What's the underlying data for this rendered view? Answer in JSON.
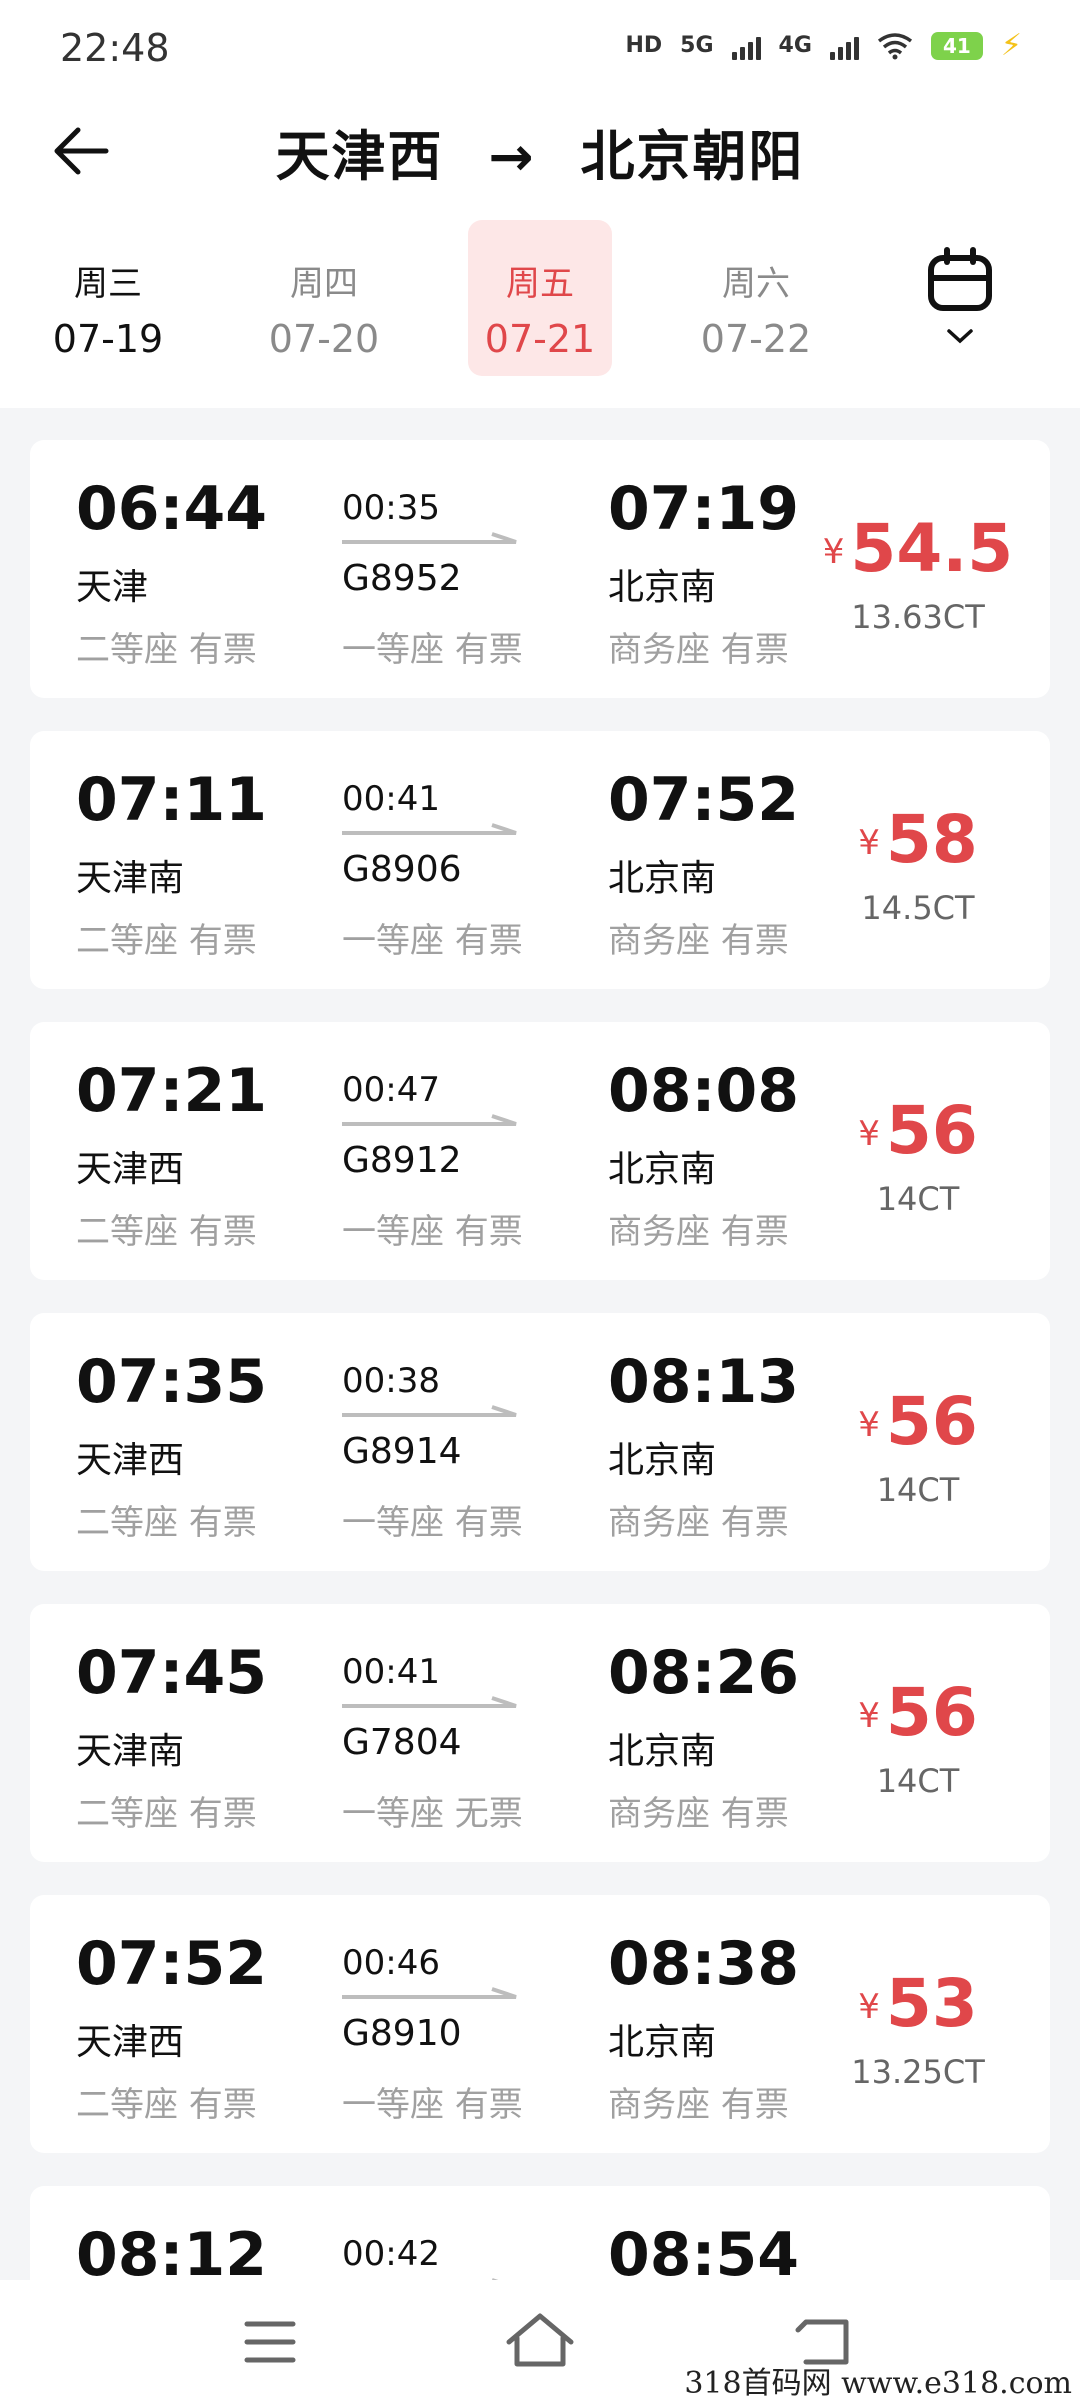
{
  "status_bar": {
    "time": "22:48",
    "hd": "HD",
    "net1": "5G",
    "net2": "4G",
    "battery": "41"
  },
  "header": {
    "from": "天津西",
    "arrow": "→",
    "to": "北京朝阳"
  },
  "date_tabs": [
    {
      "weekday": "周三",
      "date": "07-19"
    },
    {
      "weekday": "周四",
      "date": "07-20"
    },
    {
      "weekday": "周五",
      "date": "07-21"
    },
    {
      "weekday": "周六",
      "date": "07-22"
    }
  ],
  "colors": {
    "accent": "#e0474a",
    "active_tab_bg": "#fde7e7",
    "muted": "#a0a0a0",
    "background": "#f4f5f7"
  },
  "trains": [
    {
      "dep_time": "06:44",
      "dep_station": "天津",
      "duration": "00:35",
      "train_no": "G8952",
      "arr_time": "07:19",
      "arr_station": "北京南",
      "seat1": "二等座 有票",
      "seat2": "一等座 有票",
      "seat3": "商务座 有票",
      "currency": "¥",
      "price": "54.5",
      "ct": "13.63CT"
    },
    {
      "dep_time": "07:11",
      "dep_station": "天津南",
      "duration": "00:41",
      "train_no": "G8906",
      "arr_time": "07:52",
      "arr_station": "北京南",
      "seat1": "二等座 有票",
      "seat2": "一等座 有票",
      "seat3": "商务座 有票",
      "currency": "¥",
      "price": "58",
      "ct": "14.5CT"
    },
    {
      "dep_time": "07:21",
      "dep_station": "天津西",
      "duration": "00:47",
      "train_no": "G8912",
      "arr_time": "08:08",
      "arr_station": "北京南",
      "seat1": "二等座 有票",
      "seat2": "一等座 有票",
      "seat3": "商务座 有票",
      "currency": "¥",
      "price": "56",
      "ct": "14CT"
    },
    {
      "dep_time": "07:35",
      "dep_station": "天津西",
      "duration": "00:38",
      "train_no": "G8914",
      "arr_time": "08:13",
      "arr_station": "北京南",
      "seat1": "二等座 有票",
      "seat2": "一等座 有票",
      "seat3": "商务座 有票",
      "currency": "¥",
      "price": "56",
      "ct": "14CT"
    },
    {
      "dep_time": "07:45",
      "dep_station": "天津南",
      "duration": "00:41",
      "train_no": "G7804",
      "arr_time": "08:26",
      "arr_station": "北京南",
      "seat1": "二等座 有票",
      "seat2": "一等座 无票",
      "seat3": "商务座 有票",
      "currency": "¥",
      "price": "56",
      "ct": "14CT"
    },
    {
      "dep_time": "07:52",
      "dep_station": "天津西",
      "duration": "00:46",
      "train_no": "G8910",
      "arr_time": "08:38",
      "arr_station": "北京南",
      "seat1": "二等座 有票",
      "seat2": "一等座 有票",
      "seat3": "商务座 有票",
      "currency": "¥",
      "price": "53",
      "ct": "13.25CT"
    },
    {
      "dep_time": "08:12",
      "dep_station": "",
      "duration": "00:42",
      "train_no": "",
      "arr_time": "08:54",
      "arr_station": "",
      "seat1": "",
      "seat2": "",
      "seat3": "",
      "currency": "",
      "price": "",
      "ct": ""
    }
  ],
  "watermark": "318首码网  www.e318.com"
}
